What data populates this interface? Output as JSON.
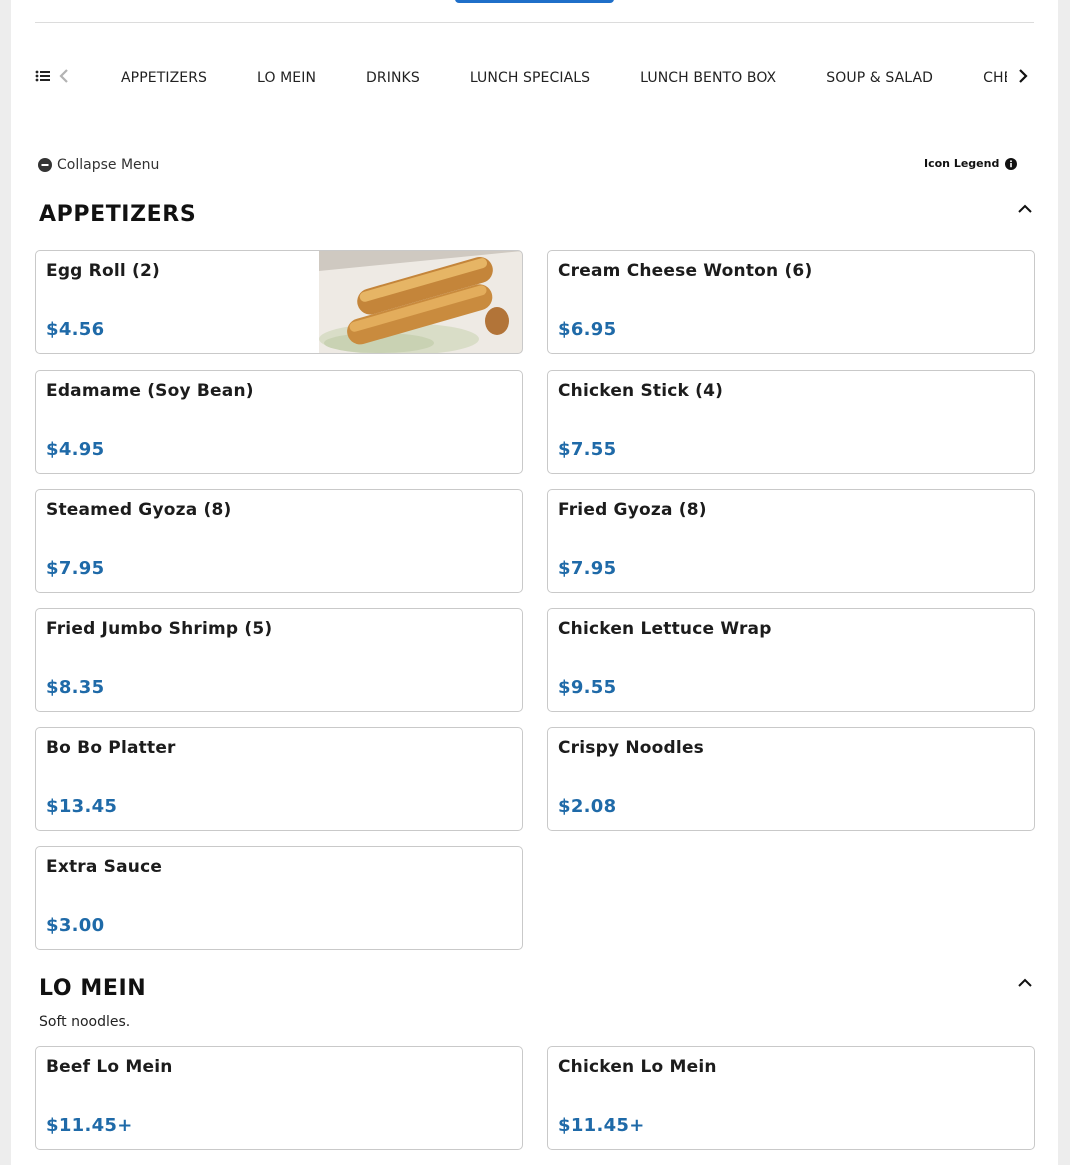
{
  "categories": {
    "items": [
      "APPETIZERS",
      "LO MEIN",
      "DRINKS",
      "LUNCH SPECIALS",
      "LUNCH BENTO BOX",
      "SOUP & SALAD",
      "CHEF'S SPECIALS"
    ]
  },
  "controls": {
    "collapse_label": "Collapse Menu",
    "legend_label": "Icon Legend"
  },
  "sections": [
    {
      "title": "APPETIZERS",
      "description": "",
      "items": [
        {
          "name": "Egg Roll (2)",
          "price": "$4.56",
          "has_photo": true
        },
        {
          "name": "Cream Cheese Wonton (6)",
          "price": "$6.95"
        },
        {
          "name": "Edamame (Soy Bean)",
          "price": "$4.95"
        },
        {
          "name": "Chicken Stick (4)",
          "price": "$7.55"
        },
        {
          "name": "Steamed Gyoza (8)",
          "price": "$7.95"
        },
        {
          "name": "Fried Gyoza (8)",
          "price": "$7.95"
        },
        {
          "name": "Fried Jumbo Shrimp (5)",
          "price": "$8.35"
        },
        {
          "name": "Chicken Lettuce Wrap",
          "price": "$9.55"
        },
        {
          "name": "Bo Bo Platter",
          "price": "$13.45"
        },
        {
          "name": "Crispy Noodles",
          "price": "$2.08"
        },
        {
          "name": "Extra Sauce",
          "price": "$3.00"
        }
      ]
    },
    {
      "title": "LO MEIN",
      "description": "Soft noodles.",
      "items": [
        {
          "name": "Beef Lo Mein",
          "price": "$11.45+"
        },
        {
          "name": "Chicken Lo Mein",
          "price": "$11.45+"
        }
      ]
    }
  ],
  "colors": {
    "price": "#1f6aa8",
    "accent_button": "#1f6fc9",
    "card_border": "#c9c9c9"
  }
}
